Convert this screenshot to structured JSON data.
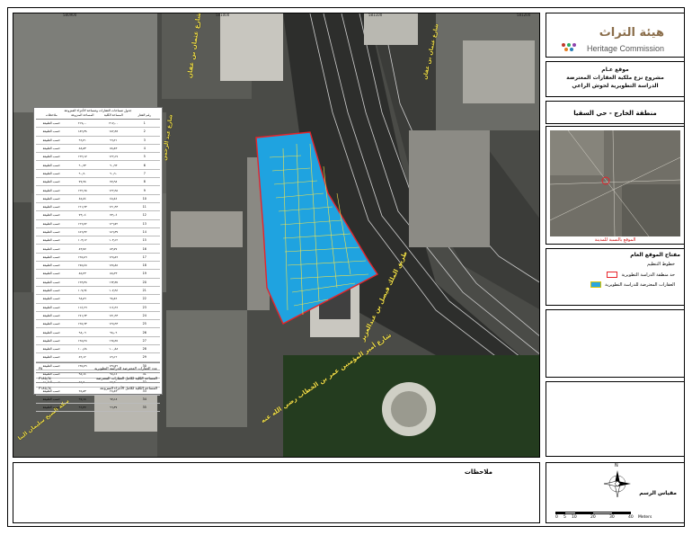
{
  "header": {
    "logo_ar": "هيئة التراث",
    "logo_en": "Heritage Commission"
  },
  "title": {
    "line1": "موقع عـام",
    "line2": "مشروع نزع ملكية العقارات المعترضة",
    "line3": "الدراسة التطويرية لحوش الراعي"
  },
  "region": "منطقة الخارج - حي السقيا",
  "inset_caption": "الموقع بالنسبة للمدينة",
  "legend": {
    "title": "مفتاح الموقع العام",
    "subtitle": "خطوط التنظيم",
    "items": [
      {
        "label": "حد منطقة الدراسة التطويرية",
        "color": "#e8232a",
        "fill": "#ffffff"
      },
      {
        "label": "العقارات المعترضة للدراسة التطويرية",
        "color": "#2aa6e0",
        "fill": "#2aa6e0"
      }
    ]
  },
  "notes_label": "ملاحظات",
  "scale": {
    "title": "مقياس الرسم",
    "labels": [
      "0",
      "5",
      "10",
      "20",
      "30",
      "40"
    ],
    "unit": "Meters",
    "north": "N"
  },
  "table": {
    "title": "جدول مساحات العقارات ومساحة الأجزاء المنزوعة",
    "headers": [
      "رقم العقار",
      "المساحة الكلية",
      "المساحة المنزوعة",
      "ملاحظات"
    ],
    "rows": [
      [
        "1",
        "٢١٧٫٠٠",
        "٢١٧٫٠٠",
        "حسب الطبيعة"
      ],
      [
        "2",
        "١٨٢٫٣٨",
        "١٨٢٫٣٨",
        "حسب الطبيعة"
      ],
      [
        "3",
        "٩٦٫٢١",
        "٩٦٫٢١",
        "حسب الطبيعة"
      ],
      [
        "4",
        "٥٨٫٨٣",
        "٥٨٫٨٣",
        "حسب الطبيعة"
      ],
      [
        "5",
        "١٢٢٫١٧",
        "١٢٢٫١٧",
        "حسب الطبيعة"
      ],
      [
        "6",
        "٩٠٫٦٣",
        "٩٠٫٦٣",
        "حسب الطبيعة"
      ],
      [
        "7",
        "٩٠٫٦٠",
        "٩٠٫٦٠",
        "حسب الطبيعة"
      ],
      [
        "8",
        "٧٧٫٩٨",
        "٧٧٫٩٨",
        "حسب الطبيعة"
      ],
      [
        "9",
        "١٢٢٫٦٥",
        "١٢٢٫٦٥",
        "حسب الطبيعة"
      ],
      [
        "10",
        "٤٥٫٤٤",
        "٤٥٫٤٤",
        "حسب الطبيعة"
      ],
      [
        "11",
        "١٢١٫٩٣",
        "١٢١٫٩٣",
        "حسب الطبيعة"
      ],
      [
        "12",
        "٧٣٫٠٤",
        "٧٣٫٠٤",
        "حسب الطبيعة"
      ],
      [
        "13",
        "١٢٦٫٧٢",
        "١٢٦٫٧٢",
        "حسب الطبيعة"
      ],
      [
        "14",
        "١٥٦٫٣٧",
        "١٥٦٫٣٧",
        "حسب الطبيعة"
      ],
      [
        "15",
        "١٠٣٫١٢",
        "١٠٣٫١٢",
        "حسب الطبيعة"
      ],
      [
        "16",
        "٨٣٫٧٧",
        "٨٣٫٧٧",
        "حسب الطبيعة"
      ],
      [
        "17",
        "١٢٥٫٥٦",
        "١٢٥٫٥٦",
        "حسب الطبيعة"
      ],
      [
        "18",
        "١٧٥٫٤٥",
        "١٧٥٫٤٥",
        "حسب الطبيعة"
      ],
      [
        "19",
        "٨٥٫٢٣",
        "٨٥٫٢٣",
        "حسب الطبيعة"
      ],
      [
        "20",
        "١٦٣٫٣٥",
        "١٦٣٫٣٥",
        "حسب الطبيعة"
      ],
      [
        "21",
        "١٠٧٫٩٤",
        "١٠٧٫٩٤",
        "حسب الطبيعة"
      ],
      [
        "22",
        "٩٨٫٨٦",
        "٩٨٫٨٦",
        "حسب الطبيعة"
      ],
      [
        "23",
        "١١٤٫٦٦",
        "١١٤٫٦٦",
        "حسب الطبيعة"
      ],
      [
        "24",
        "١٧١٫٦٣",
        "١٧١٫٦٣",
        "حسب الطبيعة"
      ],
      [
        "25",
        "١٢٥٫٦٣",
        "١٢٥٫٦٣",
        "حسب الطبيعة"
      ],
      [
        "26",
        "٩٨٫٠٩",
        "٩٨٫٠٩",
        "حسب الطبيعة"
      ],
      [
        "27",
        "١٦٥٫٢٥",
        "١٦٥٫٢٥",
        "حسب الطبيعة"
      ],
      [
        "28",
        "١٠٠٫٤٨",
        "١٠٠٫٤٨",
        "حسب الطبيعة"
      ],
      [
        "29",
        "٥٩٫١٢",
        "٥٩٫١٢",
        "حسب الطبيعة"
      ],
      [
        "30",
        "١٣٥٫٧٩",
        "١٣٥٫٧٩",
        "حسب الطبيعة"
      ],
      [
        "31",
        "٩٥٫١٤",
        "٩٥٫١٤",
        "حسب الطبيعة"
      ],
      [
        "32",
        "٥٥٫٦٠",
        "٥٥٫٦٠",
        "حسب الطبيعة"
      ],
      [
        "33",
        "٢٥٫٨٣",
        "٢٥٫٨٣",
        "حسب الطبيعة"
      ],
      [
        "34",
        "٦٧٫١٨",
        "٦٧٫١٨",
        "حسب الطبيعة"
      ],
      [
        "35",
        "٩٦٫٣٧",
        "٩٦٫٣٧",
        "حسب الطبيعة"
      ]
    ],
    "footer": [
      [
        "عدد العقارات المعترضة للدراسة التطويرية",
        "٣٥"
      ],
      [
        "المساحة الكلية لكامل العقارات المعترضة",
        "٣١٨٥٫٦٤"
      ],
      [
        "المساحة الكلية لكامل الأجزاء المنزوعة",
        "٣١٨٥٫٦٤"
      ]
    ]
  },
  "map": {
    "streets": [
      "شارع عثمان بن عفان",
      "شارع عبد الرحمن",
      "طريق الملك فيصل بن عبدالعزيز",
      "شارع أمير المؤمنين عمر بن الخطاب رضي الله عنه",
      "سكة الشيخ سليمان البنا"
    ],
    "ticks_x": [
      "580900",
      "581000",
      "581100",
      "581200"
    ],
    "ticks_y": [
      "2703800",
      "2703700",
      "2703600",
      "2703500"
    ]
  }
}
